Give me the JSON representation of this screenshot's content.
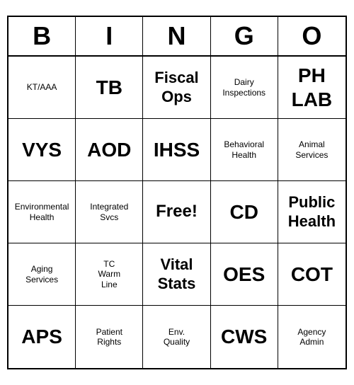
{
  "header": {
    "letters": [
      "B",
      "I",
      "N",
      "G",
      "O"
    ]
  },
  "cells": [
    {
      "text": "KT/AAA",
      "size": "small"
    },
    {
      "text": "TB",
      "size": "large"
    },
    {
      "text": "Fiscal\nOps",
      "size": "medium"
    },
    {
      "text": "Dairy\nInspections",
      "size": "small"
    },
    {
      "text": "PH\nLAB",
      "size": "large"
    },
    {
      "text": "VYS",
      "size": "large"
    },
    {
      "text": "AOD",
      "size": "large"
    },
    {
      "text": "IHSS",
      "size": "large"
    },
    {
      "text": "Behavioral\nHealth",
      "size": "small"
    },
    {
      "text": "Animal\nServices",
      "size": "small"
    },
    {
      "text": "Environmental\nHealth",
      "size": "small"
    },
    {
      "text": "Integrated\nSvcs",
      "size": "small"
    },
    {
      "text": "Free!",
      "size": "free"
    },
    {
      "text": "CD",
      "size": "large"
    },
    {
      "text": "Public\nHealth",
      "size": "medium"
    },
    {
      "text": "Aging\nServices",
      "size": "small"
    },
    {
      "text": "TC\nWarm\nLine",
      "size": "small"
    },
    {
      "text": "Vital\nStats",
      "size": "medium"
    },
    {
      "text": "OES",
      "size": "large"
    },
    {
      "text": "COT",
      "size": "large"
    },
    {
      "text": "APS",
      "size": "large"
    },
    {
      "text": "Patient\nRights",
      "size": "small"
    },
    {
      "text": "Env.\nQuality",
      "size": "small"
    },
    {
      "text": "CWS",
      "size": "large"
    },
    {
      "text": "Agency\nAdmin",
      "size": "small"
    }
  ]
}
